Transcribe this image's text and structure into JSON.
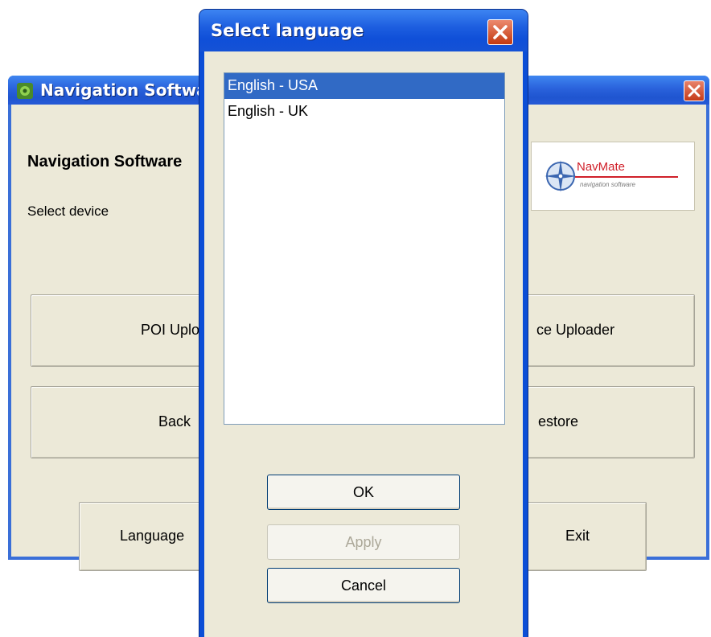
{
  "main_window": {
    "title": "Navigation Software",
    "heading": "Navigation Software",
    "device_label": "Select device",
    "logo": {
      "name": "NavMate",
      "tagline": "navigation software"
    },
    "buttons": {
      "poi_uploader": {
        "left_text": "POI Uplo",
        "right_text": "ce Uploader"
      },
      "backup_restore": {
        "left_text": "Back",
        "right_text": "estore"
      },
      "language": "Language",
      "exit": "Exit"
    }
  },
  "dialog": {
    "title": "Select language",
    "languages": [
      {
        "label": "English - USA",
        "selected": true
      },
      {
        "label": "English - UK",
        "selected": false
      }
    ],
    "buttons": {
      "ok": "OK",
      "apply": "Apply",
      "cancel": "Cancel"
    }
  },
  "colors": {
    "title_bar": "#0b4ed6",
    "window_bg": "#ece9d8",
    "selection": "#316ac5",
    "close_button": "#c3380f",
    "logo_accent": "#d0202a"
  },
  "icons": [
    "app-icon",
    "close-icon",
    "compass-logo-icon"
  ]
}
